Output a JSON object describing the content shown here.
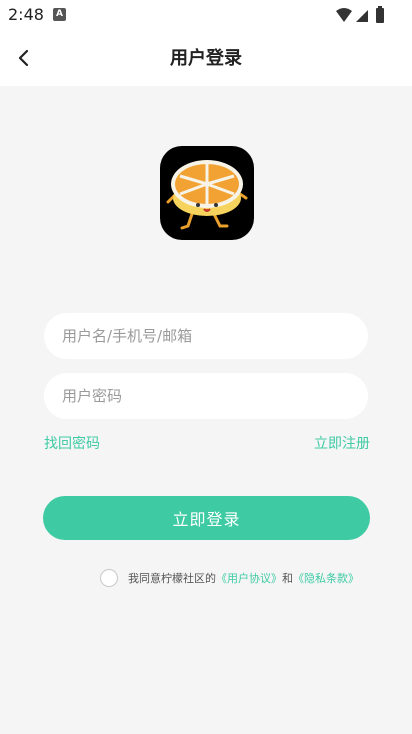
{
  "status_bar": {
    "time": "2:48",
    "app_icon_letter": "A"
  },
  "header": {
    "title": "用户登录"
  },
  "form": {
    "username_placeholder": "用户名/手机号/邮箱",
    "password_placeholder": "用户密码",
    "forgot_password": "找回密码",
    "register": "立即注册",
    "login_button": "立即登录"
  },
  "agreement": {
    "prefix": "我同意柠檬社区的",
    "user_agreement": "《用户协议》",
    "conjunction": "和",
    "privacy_policy": "《隐私条款》"
  },
  "colors": {
    "accent": "#3ecba3",
    "background": "#f5f5f5"
  }
}
